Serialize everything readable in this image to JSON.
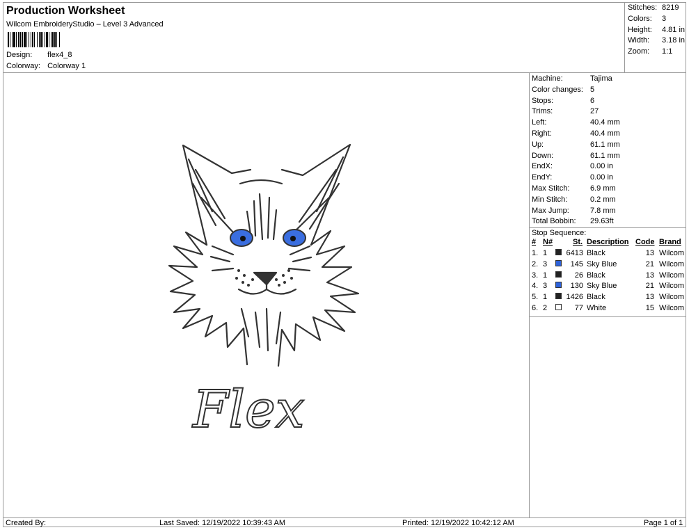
{
  "header": {
    "title": "Production Worksheet",
    "subtitle": "Wilcom EmbroideryStudio – Level 3 Advanced",
    "design_label": "Design:",
    "design_value": "flex4_8",
    "colorway_label": "Colorway:",
    "colorway_value": "Colorway 1"
  },
  "summary": [
    {
      "label": "Stitches:",
      "value": "8219"
    },
    {
      "label": "Colors:",
      "value": "3"
    },
    {
      "label": "Height:",
      "value": "4.81 in"
    },
    {
      "label": "Width:",
      "value": "3.18 in"
    },
    {
      "label": "Zoom:",
      "value": "1:1"
    }
  ],
  "details": [
    {
      "label": "Machine:",
      "value": "Tajima"
    },
    {
      "label": "Color changes:",
      "value": "5"
    },
    {
      "label": "Stops:",
      "value": "6"
    },
    {
      "label": "Trims:",
      "value": "27"
    },
    {
      "label": "Left:",
      "value": "40.4 mm"
    },
    {
      "label": "Right:",
      "value": "40.4 mm"
    },
    {
      "label": "Up:",
      "value": "61.1 mm"
    },
    {
      "label": "Down:",
      "value": "61.1 mm"
    },
    {
      "label": "EndX:",
      "value": "0.00 in"
    },
    {
      "label": "EndY:",
      "value": "0.00 in"
    },
    {
      "label": "Max Stitch:",
      "value": "6.9 mm"
    },
    {
      "label": "Min Stitch:",
      "value": "0.2 mm"
    },
    {
      "label": "Max Jump:",
      "value": "7.8 mm"
    },
    {
      "label": "Total Bobbin:",
      "value": "29.63ft"
    }
  ],
  "stop_sequence": {
    "title": "Stop Sequence:",
    "columns": [
      "#",
      "N#",
      "St.",
      "Description",
      "Code",
      "Brand"
    ],
    "rows": [
      {
        "num": "1.",
        "n": "1",
        "color": "#222222",
        "st": "6413",
        "desc": "Black",
        "code": "13",
        "brand": "Wilcom"
      },
      {
        "num": "2.",
        "n": "3",
        "color": "#2e62d9",
        "st": "145",
        "desc": "Sky Blue",
        "code": "21",
        "brand": "Wilcom"
      },
      {
        "num": "3.",
        "n": "1",
        "color": "#222222",
        "st": "26",
        "desc": "Black",
        "code": "13",
        "brand": "Wilcom"
      },
      {
        "num": "4.",
        "n": "3",
        "color": "#2e62d9",
        "st": "130",
        "desc": "Sky Blue",
        "code": "21",
        "brand": "Wilcom"
      },
      {
        "num": "5.",
        "n": "1",
        "color": "#222222",
        "st": "1426",
        "desc": "Black",
        "code": "13",
        "brand": "Wilcom"
      },
      {
        "num": "6.",
        "n": "2",
        "color": "#ffffff",
        "st": "77",
        "desc": "White",
        "code": "15",
        "brand": "Wilcom"
      }
    ]
  },
  "design_text": "Flex",
  "footer": {
    "created": "Created By:",
    "saved": "Last Saved: 12/19/2022 10:39:43 AM",
    "printed": "Printed: 12/19/2022 10:42:12 AM",
    "page": "Page 1 of 1"
  }
}
